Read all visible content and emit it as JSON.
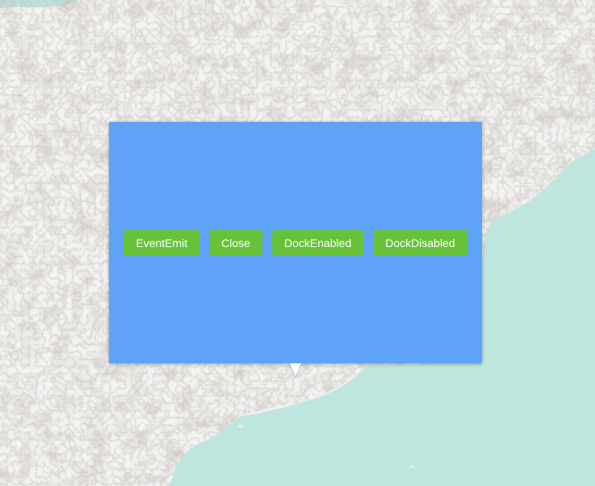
{
  "map": {
    "land_color": "#f4f3f1",
    "water_color": "#bfe5df",
    "relief_color": "#d8d3cf"
  },
  "popup": {
    "background": "#5fa3f8",
    "button_color": "#67c23a",
    "buttons": [
      {
        "label": "EventEmit"
      },
      {
        "label": "Close"
      },
      {
        "label": "DockEnabled"
      },
      {
        "label": "DockDisabled"
      }
    ]
  }
}
